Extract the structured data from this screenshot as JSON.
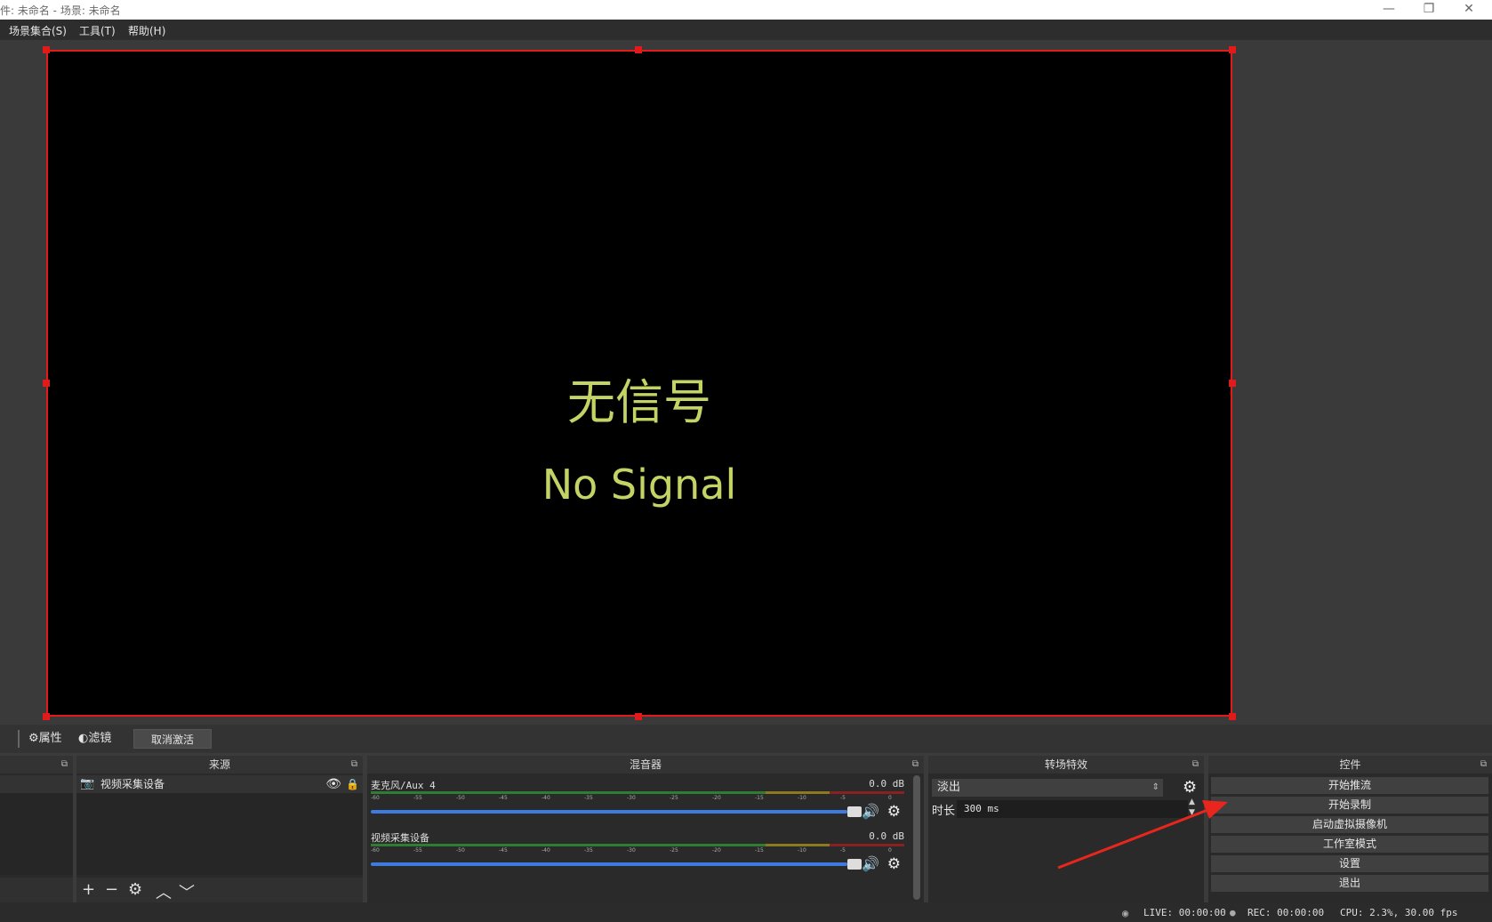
{
  "window": {
    "title": "件: 未命名 - 场景: 未命名",
    "minimize_icon": "—",
    "restore_icon": "❐",
    "close_icon": "✕"
  },
  "menu": [
    {
      "label": "场景集合(S)"
    },
    {
      "label": "工具(T)"
    },
    {
      "label": "帮助(H)"
    }
  ],
  "preview": {
    "no_signal_cn": "无信号",
    "no_signal_en": "No Signal"
  },
  "source_toolbar": {
    "properties_label": "属性",
    "filters_label": "滤镜",
    "deactivate_label": "取消激活"
  },
  "sources": {
    "header": "来源",
    "items": [
      {
        "name": "视频采集设备"
      }
    ]
  },
  "mixer": {
    "header": "混音器",
    "channels": [
      {
        "name": "麦克风/Aux 4",
        "db": "0.0 dB"
      },
      {
        "name": "视频采集设备",
        "db": "0.0 dB"
      }
    ],
    "ticks": [
      "-60",
      "-55",
      "-50",
      "-45",
      "-40",
      "-35",
      "-30",
      "-25",
      "-20",
      "-15",
      "-10",
      "-5",
      "0"
    ]
  },
  "transitions": {
    "header": "转场特效",
    "selected": "淡出",
    "duration_label": "时长",
    "duration_value": "300 ms"
  },
  "controls": {
    "header": "控件",
    "buttons": [
      {
        "label": "开始推流"
      },
      {
        "label": "开始录制"
      },
      {
        "label": "启动虚拟摄像机"
      },
      {
        "label": "工作室模式"
      },
      {
        "label": "设置"
      },
      {
        "label": "退出"
      }
    ]
  },
  "status": {
    "live": "LIVE: 00:00:00",
    "rec": "REC: 00:00:00",
    "cpu": "CPU: 2.3%, 30.00 fps"
  },
  "colors": {
    "accent": "#3d7be0",
    "selection_border": "#e21a1a",
    "no_signal_text": "#c3d464",
    "annotation_arrow": "#e8261e"
  }
}
